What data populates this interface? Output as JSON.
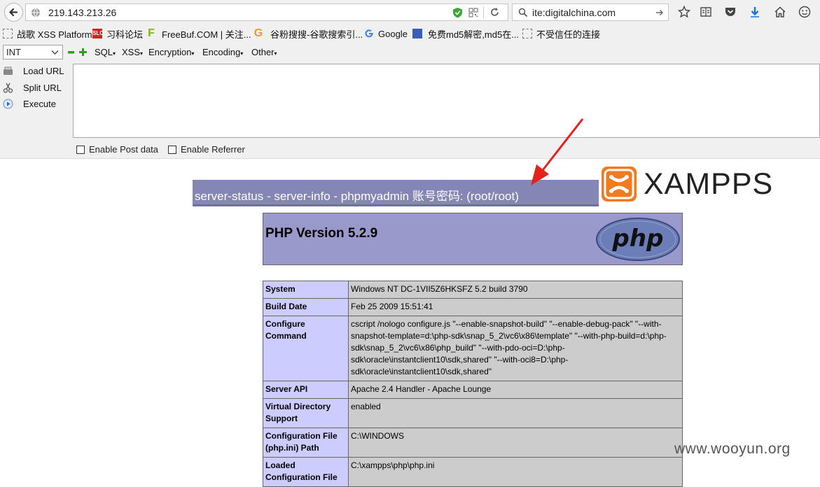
{
  "browser": {
    "url": "219.143.213.26",
    "search_value": "ite:digitalchina.com"
  },
  "bookmarks": [
    {
      "label": "战歌 XSS Platform",
      "icon": "page-icon"
    },
    {
      "label": "习科论坛",
      "icon": "slc-icon"
    },
    {
      "label": "FreeBuf.COM | 关注...",
      "icon": "freebuf-icon"
    },
    {
      "label": "谷粉搜搜-谷歌搜索引...",
      "icon": "g-icon"
    },
    {
      "label": "Google",
      "icon": "google-icon"
    },
    {
      "label": "免费md5解密,md5在...",
      "icon": "md5-icon"
    },
    {
      "label": "不受信任的连接",
      "icon": "page-icon"
    }
  ],
  "hackbar": {
    "select_value": "INT",
    "menus": [
      "SQL",
      "XSS",
      "Encryption",
      "Encoding",
      "Other"
    ],
    "side_buttons": [
      "Load URL",
      "Split URL",
      "Execute"
    ],
    "checkboxes": [
      "Enable Post data",
      "Enable Referrer"
    ]
  },
  "page": {
    "banner_text": "server-status - server-info - phpmyadmin 账号密码: (root/root)",
    "logo_text": "XAMPPS",
    "php_version": "PHP Version 5.2.9",
    "php_logo": "php",
    "rows": [
      {
        "key": "System",
        "value": "Windows NT DC-1VII5Z6HKSFZ 5.2 build 3790"
      },
      {
        "key": "Build Date",
        "value": "Feb 25 2009 15:51:41"
      },
      {
        "key": "Configure Command",
        "value": "cscript /nologo configure.js \"--enable-snapshot-build\" \"--enable-debug-pack\" \"--with-snapshot-template=d:\\php-sdk\\snap_5_2\\vc6\\x86\\template\" \"--with-php-build=d:\\php-sdk\\snap_5_2\\vc6\\x86\\php_build\" \"--with-pdo-oci=D:\\php-sdk\\oracle\\instantclient10\\sdk,shared\" \"--with-oci8=D:\\php-sdk\\oracle\\instantclient10\\sdk,shared\""
      },
      {
        "key": "Server API",
        "value": "Apache 2.4 Handler - Apache Lounge"
      },
      {
        "key": "Virtual Directory Support",
        "value": "enabled"
      },
      {
        "key": "Configuration File (php.ini) Path",
        "value": "C:\\WINDOWS"
      },
      {
        "key": "Loaded Configuration File",
        "value": "C:\\xampps\\php\\php.ini"
      }
    ]
  },
  "watermark": "www.wooyun.org"
}
